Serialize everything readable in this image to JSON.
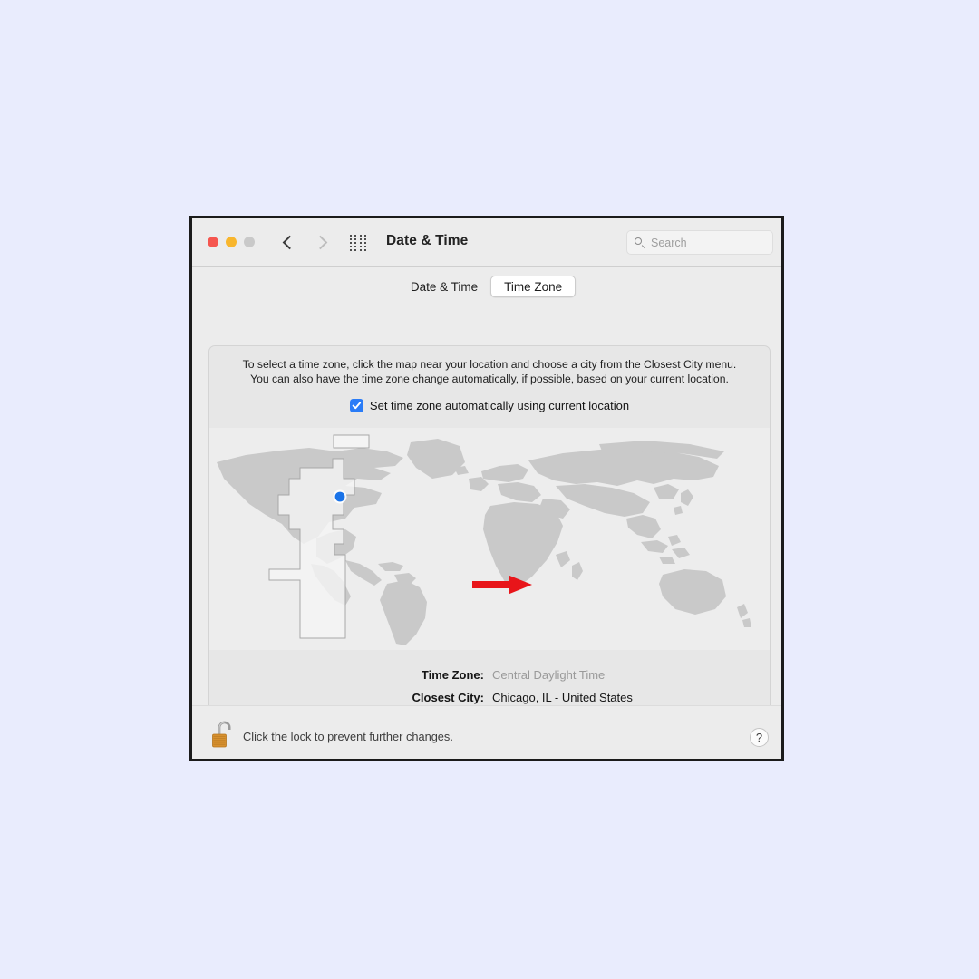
{
  "window": {
    "title": "Date & Time",
    "traffic_lights": [
      "close",
      "minimize",
      "zoom"
    ],
    "nav": {
      "back": "back",
      "forward": "forward"
    },
    "grid_icon": "show-all-icon",
    "search": {
      "placeholder": "Search",
      "value": ""
    }
  },
  "tabs": [
    {
      "label": "Date & Time",
      "active": false
    },
    {
      "label": "Time Zone",
      "active": true
    }
  ],
  "panel": {
    "description_line1": "To select a time zone, click the map near your location and choose a city from the Closest City menu.",
    "description_line2": "You can also have the time zone change automatically, if possible, based on your current location.",
    "checkbox": {
      "label": "Set time zone automatically using current location",
      "checked": true,
      "accent_color": "#2a7cf7"
    },
    "map": {
      "land_color": "#c9c9c9",
      "ocean_color": "#ededed",
      "highlight_zone": "Central",
      "marker_color": "#1a73e8",
      "marker_label": "current-location"
    },
    "info": [
      {
        "label": "Time Zone:",
        "value": "Central Daylight Time",
        "style": "muted"
      },
      {
        "label": "Closest City:",
        "value": "Chicago, IL - United States",
        "style": "strong"
      }
    ]
  },
  "footer": {
    "lock_icon": "unlocked-padlock-icon",
    "text": "Click the lock to prevent further changes.",
    "help_label": "?"
  },
  "annotation": {
    "arrow_color": "#e8151a",
    "points_to": "auto-tz-checkbox"
  }
}
